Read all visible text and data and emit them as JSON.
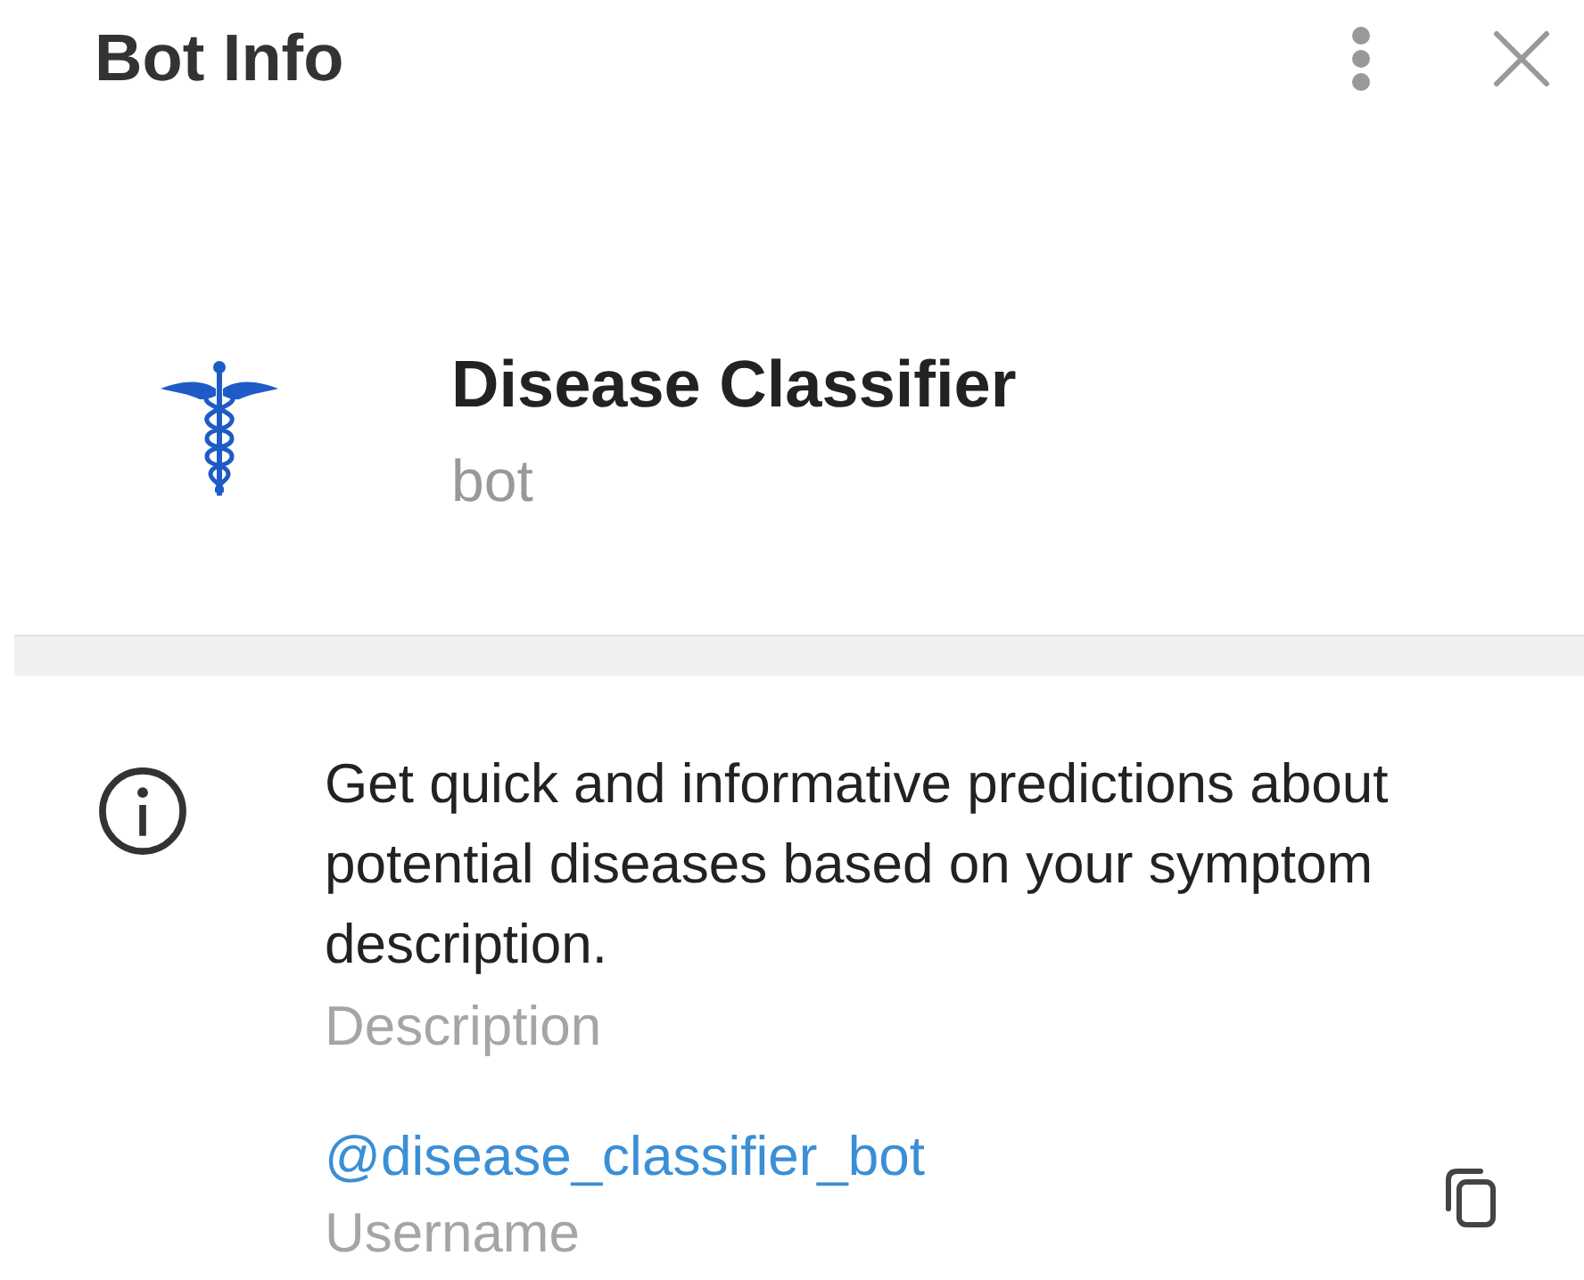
{
  "header": {
    "title": "Bot Info"
  },
  "profile": {
    "name": "Disease Classifier",
    "subtitle": "bot"
  },
  "info_rows": [
    {
      "kind": "text",
      "value": "Get quick and informative predictions about potential diseases based on your symptom description.",
      "label": "Description"
    },
    {
      "kind": "link",
      "value": "@disease_classifier_bot",
      "label": "Username"
    }
  ]
}
